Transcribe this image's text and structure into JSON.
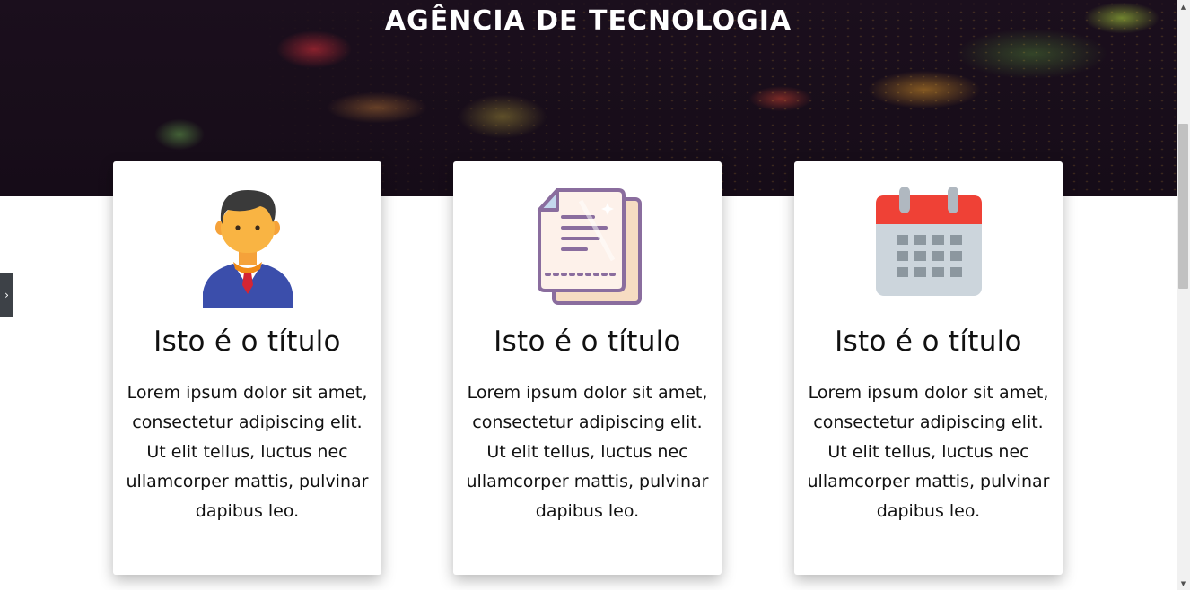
{
  "hero": {
    "title": "AGÊNCIA DE TECNOLOGIA"
  },
  "side_tab": {
    "icon": "chevron-right-icon",
    "glyph": "›"
  },
  "cards": [
    {
      "icon": "businessman-icon",
      "title": "Isto é o título",
      "text": "Lorem ipsum dolor sit amet, consectetur adipiscing elit. Ut elit tellus, luctus nec ullamcorper mattis, pulvinar dapibus leo."
    },
    {
      "icon": "document-icon",
      "title": "Isto é o título",
      "text": "Lorem ipsum dolor sit amet, consectetur adipiscing elit. Ut elit tellus, luctus nec ullamcorper mattis, pulvinar dapibus leo."
    },
    {
      "icon": "calendar-icon",
      "title": "Isto é o título",
      "text": "Lorem ipsum dolor sit amet, consectetur adipiscing elit. Ut elit tellus, luctus nec ullamcorper mattis, pulvinar dapibus leo."
    }
  ],
  "colors": {
    "hero_background": "#160c18",
    "card_background": "#ffffff",
    "text": "#111111",
    "side_tab": "#3d4147"
  }
}
